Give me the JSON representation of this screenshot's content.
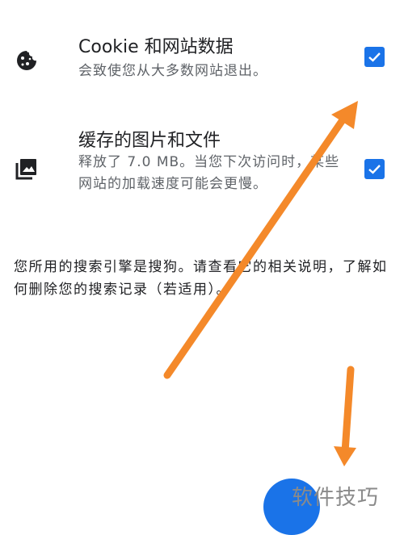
{
  "items": [
    {
      "title": "Cookie 和网站数据",
      "description": "会致使您从大多数网站退出。",
      "checked": true,
      "icon": "cookie-icon"
    },
    {
      "title": "缓存的图片和文件",
      "description": "释放了 7.0 MB。当您下次访问时，某些网站的加载速度可能会更慢。",
      "checked": true,
      "icon": "image-icon"
    }
  ],
  "note": "您所用的搜索引擎是搜狗。请查看它的相关说明，了解如何删除您的搜索记录（若适用）。",
  "watermark": "软件技巧",
  "colors": {
    "accent": "#1a73e8",
    "annotation_arrow": "#f4892a"
  }
}
